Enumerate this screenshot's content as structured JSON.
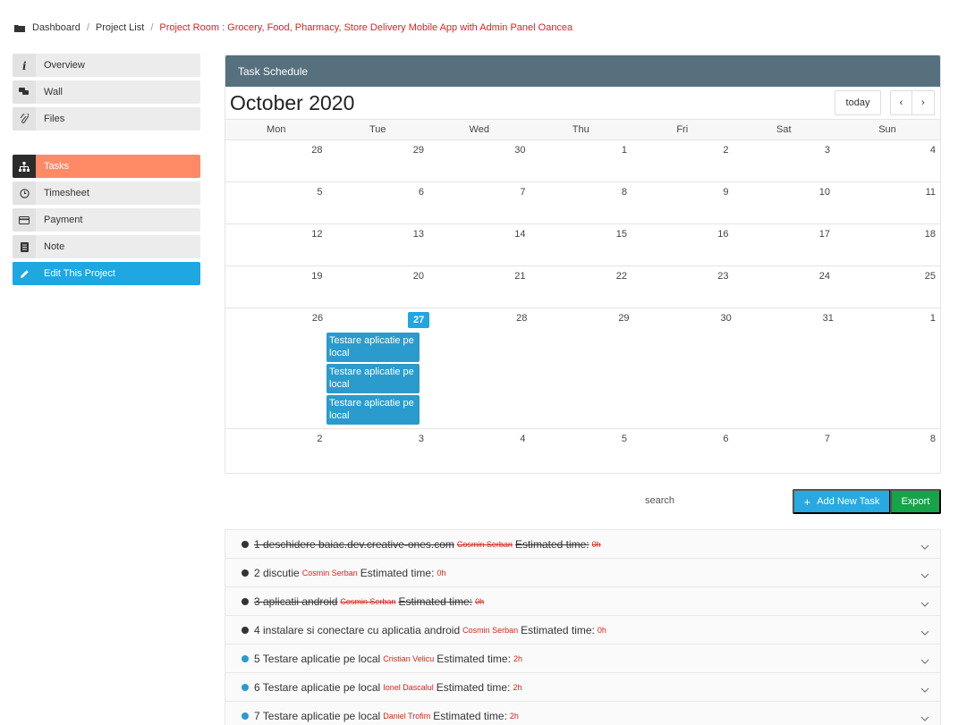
{
  "breadcrumb": {
    "items": [
      "Dashboard",
      "Project List"
    ],
    "current": "Project Room : Grocery, Food, Pharmacy, Store Delivery Mobile App with Admin Panel Oancea"
  },
  "sidebar": {
    "items": [
      {
        "label": "Overview",
        "icon": "info-icon"
      },
      {
        "label": "Wall",
        "icon": "chat-icon"
      },
      {
        "label": "Files",
        "icon": "paperclip-icon"
      },
      {
        "label": "Tasks",
        "icon": "sitemap-icon"
      },
      {
        "label": "Timesheet",
        "icon": "clock-icon"
      },
      {
        "label": "Payment",
        "icon": "credit-card-icon"
      },
      {
        "label": "Note",
        "icon": "note-icon"
      },
      {
        "label": "Edit This Project",
        "icon": "pencil-icon"
      }
    ],
    "active": "Tasks"
  },
  "calendar": {
    "panel_title": "Task Schedule",
    "title": "October 2020",
    "today_label": "today",
    "prev_label": "‹",
    "next_label": "›",
    "days_of_week": [
      "Mon",
      "Tue",
      "Wed",
      "Thu",
      "Fri",
      "Sat",
      "Sun"
    ],
    "weeks": [
      [
        "28",
        "29",
        "30",
        "1",
        "2",
        "3",
        "4"
      ],
      [
        "5",
        "6",
        "7",
        "8",
        "9",
        "10",
        "11"
      ],
      [
        "12",
        "13",
        "14",
        "15",
        "16",
        "17",
        "18"
      ],
      [
        "19",
        "20",
        "21",
        "22",
        "23",
        "24",
        "25"
      ],
      [
        "26",
        "27",
        "28",
        "29",
        "30",
        "31",
        "1"
      ],
      [
        "2",
        "3",
        "4",
        "5",
        "6",
        "7",
        "8"
      ]
    ],
    "today": "27",
    "events": [
      {
        "title": "Testare aplicatie pe local",
        "day": "27"
      },
      {
        "title": "Testare aplicatie pe local",
        "day": "27"
      },
      {
        "title": "Testare aplicatie pe local",
        "day": "27"
      }
    ]
  },
  "actions": {
    "search_label": "search",
    "add_label": "Add New Task",
    "add_icon": "plus-icon",
    "export_label": "Export"
  },
  "tasks": [
    {
      "title": "1 deschidere baiac.dev.creative-ones.com",
      "assignee": "Cosmin Serban",
      "est_label": "Estimated time:",
      "hours": "0h",
      "done": true,
      "status": "dark"
    },
    {
      "title": "2 discutie",
      "assignee": "Cosmin Serban",
      "est_label": "Estimated time:",
      "hours": "0h",
      "done": false,
      "status": "dark"
    },
    {
      "title": "3 aplicatii android",
      "assignee": "Cosmin Serban",
      "est_label": "Estimated time:",
      "hours": "0h",
      "done": true,
      "status": "dark"
    },
    {
      "title": "4 instalare si conectare cu aplicatia android",
      "assignee": "Cosmin Serban",
      "est_label": "Estimated time:",
      "hours": "0h",
      "done": false,
      "status": "dark"
    },
    {
      "title": "5 Testare aplicatie pe local",
      "assignee": "Cristian Velicu",
      "est_label": "Estimated time:",
      "hours": "2h",
      "done": false,
      "status": "blue"
    },
    {
      "title": "6 Testare aplicatie pe local",
      "assignee": "Ionel Dascalul",
      "est_label": "Estimated time:",
      "hours": "2h",
      "done": false,
      "status": "blue"
    },
    {
      "title": "7 Testare aplicatie pe local",
      "assignee": "Daniel Trofim",
      "est_label": "Estimated time:",
      "hours": "2h",
      "done": false,
      "status": "blue"
    }
  ]
}
